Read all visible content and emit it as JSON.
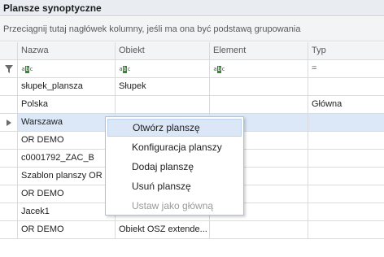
{
  "window": {
    "title": "Plansze synoptyczne"
  },
  "group_panel": {
    "hint": "Przeciągnij tutaj nagłówek kolumny, jeśli ma ona być podstawą grupowania"
  },
  "columns": [
    "Nazwa",
    "Obiekt",
    "Element",
    "Typ"
  ],
  "filter_row": {
    "text_filter_icon": "abc-filter-icon",
    "equals_icon": "=",
    "funnel_icon": "funnel-icon"
  },
  "rows": [
    {
      "nazwa": "słupek_plansza",
      "obiekt": "Słupek",
      "element": "",
      "typ": ""
    },
    {
      "nazwa": "Polska",
      "obiekt": "",
      "element": "",
      "typ": "Główna"
    },
    {
      "nazwa": "Warszawa",
      "obiekt": "",
      "element": "",
      "typ": ""
    },
    {
      "nazwa": "OR DEMO",
      "obiekt": "",
      "element": "",
      "typ": ""
    },
    {
      "nazwa": "c0001792_ZAC_B",
      "obiekt": "",
      "element": "",
      "typ": ""
    },
    {
      "nazwa": "Szablon planszy OR",
      "obiekt": "",
      "element": "",
      "typ": ""
    },
    {
      "nazwa": "OR DEMO",
      "obiekt": "",
      "element": "",
      "typ": ""
    },
    {
      "nazwa": "Jacek1",
      "obiekt": "",
      "element": "",
      "typ": ""
    },
    {
      "nazwa": "OR DEMO",
      "obiekt": "Obiekt OSZ extende...",
      "element": "",
      "typ": ""
    }
  ],
  "context_menu": {
    "items": [
      {
        "label": "Otwórz planszę"
      },
      {
        "label": "Konfiguracja planszy"
      },
      {
        "label": "Dodaj planszę"
      },
      {
        "label": "Usuń planszę"
      },
      {
        "label": "Ustaw jako główną"
      }
    ]
  },
  "colors": {
    "selected_row": "#dce8f7",
    "menu_highlight": "#dbe7f6",
    "disabled_text": "#9a9a9a"
  }
}
